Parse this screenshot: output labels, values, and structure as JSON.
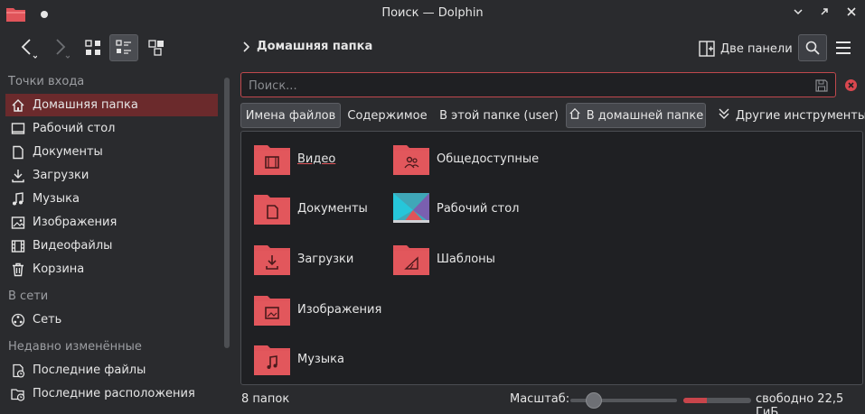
{
  "window": {
    "title": "Поиск — Dolphin"
  },
  "toolbar": {
    "breadcrumb": "Домашняя папка",
    "split_label": "Две панели"
  },
  "sidebar": {
    "places_header": "Точки входа",
    "places": [
      {
        "label": "Домашняя папка",
        "icon": "home-icon"
      },
      {
        "label": "Рабочий стол",
        "icon": "desktop-icon"
      },
      {
        "label": "Документы",
        "icon": "document-icon"
      },
      {
        "label": "Загрузки",
        "icon": "download-icon"
      },
      {
        "label": "Музыка",
        "icon": "music-icon"
      },
      {
        "label": "Изображения",
        "icon": "image-icon"
      },
      {
        "label": "Видеофайлы",
        "icon": "video-icon"
      },
      {
        "label": "Корзина",
        "icon": "trash-icon"
      }
    ],
    "network_header": "В сети",
    "network": [
      {
        "label": "Сеть",
        "icon": "network-icon"
      }
    ],
    "recent_header": "Недавно изменённые",
    "recent": [
      {
        "label": "Последние файлы",
        "icon": "recent-files-icon"
      },
      {
        "label": "Последние расположения",
        "icon": "recent-locations-icon"
      }
    ]
  },
  "search": {
    "placeholder": "Поиск...",
    "value": ""
  },
  "filters": {
    "filenames": "Имена файлов",
    "content": "Содержимое",
    "this_folder": "В этой папке (user)",
    "home_folder": "В домашней папке",
    "more_tools": "Другие инструменты"
  },
  "files": [
    {
      "name": "Видео",
      "icon": "video-folder-icon"
    },
    {
      "name": "Документы",
      "icon": "documents-folder-icon"
    },
    {
      "name": "Загрузки",
      "icon": "downloads-folder-icon"
    },
    {
      "name": "Изображения",
      "icon": "pictures-folder-icon"
    },
    {
      "name": "Музыка",
      "icon": "music-folder-icon"
    },
    {
      "name": "Общедоступные",
      "icon": "public-folder-icon"
    },
    {
      "name": "Рабочий стол",
      "icon": "desktop-folder-icon"
    },
    {
      "name": "Шаблоны",
      "icon": "templates-folder-icon"
    }
  ],
  "status": {
    "count": "8 папок",
    "zoom_label": "Масштаб:",
    "free_space": "свободно 22,5 ГиБ",
    "disk_used_fraction": 0.35
  },
  "colors": {
    "accent": "#e2575c",
    "folder": "#e0545a",
    "selection": "#6b2a2c"
  }
}
